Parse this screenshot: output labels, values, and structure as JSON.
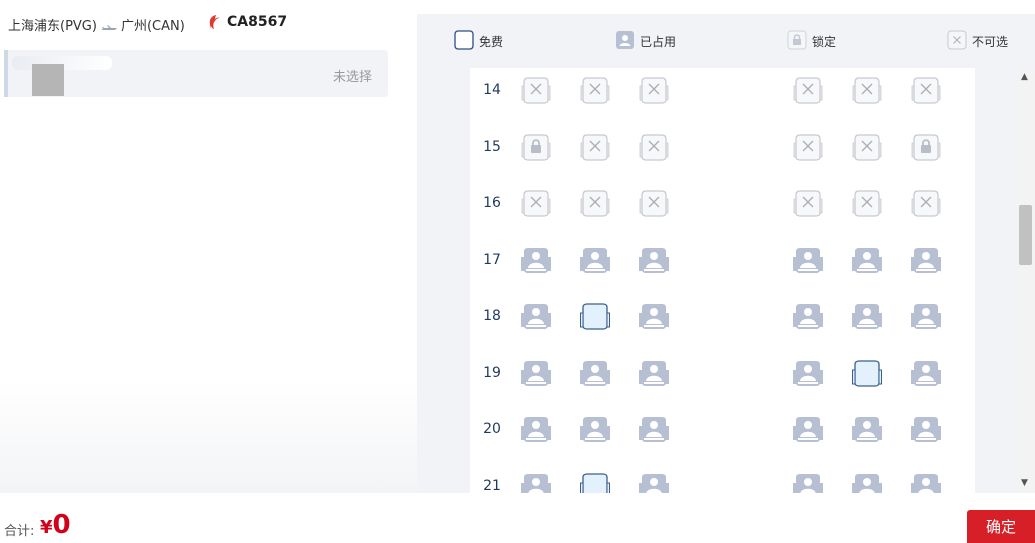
{
  "route": {
    "origin": "上海浦东(PVG)",
    "destination": "广州(CAN)",
    "flight_no": "CA8567",
    "airline_color": "#e03a30"
  },
  "passenger": {
    "status": "未选择"
  },
  "legend": [
    {
      "key": "free",
      "label": "免费"
    },
    {
      "key": "occupied",
      "label": "已占用"
    },
    {
      "key": "locked",
      "label": "锁定"
    },
    {
      "key": "unavailable",
      "label": "不可选"
    }
  ],
  "seat_rows": [
    {
      "row": "14",
      "seats": [
        "unavailable",
        "unavailable",
        "unavailable",
        "unavailable",
        "unavailable",
        "unavailable"
      ]
    },
    {
      "row": "15",
      "seats": [
        "locked",
        "unavailable",
        "unavailable",
        "unavailable",
        "unavailable",
        "locked"
      ]
    },
    {
      "row": "16",
      "seats": [
        "unavailable",
        "unavailable",
        "unavailable",
        "unavailable",
        "unavailable",
        "unavailable"
      ]
    },
    {
      "row": "17",
      "seats": [
        "occupied",
        "occupied",
        "occupied",
        "occupied",
        "occupied",
        "occupied"
      ]
    },
    {
      "row": "18",
      "seats": [
        "occupied",
        "free",
        "occupied",
        "occupied",
        "occupied",
        "occupied"
      ]
    },
    {
      "row": "19",
      "seats": [
        "occupied",
        "occupied",
        "occupied",
        "occupied",
        "free",
        "occupied"
      ]
    },
    {
      "row": "20",
      "seats": [
        "occupied",
        "occupied",
        "occupied",
        "occupied",
        "occupied",
        "occupied"
      ]
    },
    {
      "row": "21",
      "seats": [
        "occupied",
        "free",
        "occupied",
        "occupied",
        "occupied",
        "occupied"
      ]
    }
  ],
  "footer": {
    "total_label": "合计:",
    "currency": "¥",
    "total_amount": "0",
    "confirm_label": "确定"
  },
  "colors": {
    "accent": "#d61f26",
    "free_fill": "#e3f1fc",
    "free_border": "#3a5f8a",
    "occupied": "#b7bfd3",
    "unavailable_border": "#c7c9cf"
  }
}
